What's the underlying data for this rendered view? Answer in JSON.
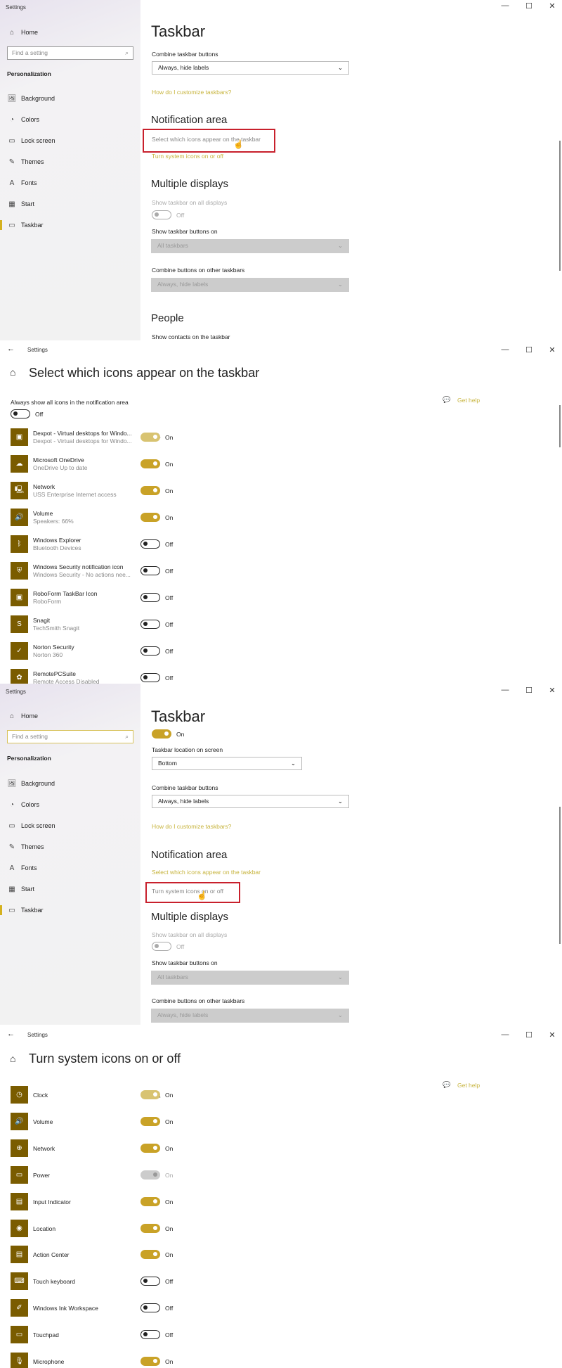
{
  "window": {
    "title": "Settings",
    "minimize": "—",
    "maximize": "☐",
    "close": "✕",
    "back": "←"
  },
  "sidebar": {
    "home": "Home",
    "search_placeholder": "Find a setting",
    "search_icon": "⌕",
    "section": "Personalization",
    "items": [
      {
        "label": "Background",
        "icon": "🖼"
      },
      {
        "label": "Colors",
        "icon": "◔"
      },
      {
        "label": "Lock screen",
        "icon": "▭"
      },
      {
        "label": "Themes",
        "icon": "✎"
      },
      {
        "label": "Fonts",
        "icon": "A"
      },
      {
        "label": "Start",
        "icon": "▦"
      },
      {
        "label": "Taskbar",
        "icon": "▭",
        "selected": true
      }
    ]
  },
  "taskbar_page": {
    "title": "Taskbar",
    "lock_toggle_state": "On",
    "location_label": "Taskbar location on screen",
    "location_value": "Bottom",
    "combine_label": "Combine taskbar buttons",
    "combine_value": "Always, hide labels",
    "customize_link": "How do I customize taskbars?",
    "notification_heading": "Notification area",
    "select_icons_link": "Select which icons appear on the taskbar",
    "system_icons_link": "Turn system icons on or off",
    "multiple_heading": "Multiple displays",
    "show_all_displays_label": "Show taskbar on all displays",
    "show_all_displays_state": "Off",
    "buttons_on_label": "Show taskbar buttons on",
    "buttons_on_value": "All taskbars",
    "combine_other_label": "Combine buttons on other taskbars",
    "combine_other_value": "Always, hide labels",
    "people_heading": "People",
    "show_contacts_label": "Show contacts on the taskbar"
  },
  "select_icons_page": {
    "title": "Select which icons appear on the taskbar",
    "get_help": "Get help",
    "always_show_label": "Always show all icons in the notification area",
    "always_show_state": "Off",
    "items": [
      {
        "name": "Dexpot - Virtual desktops for Windo...",
        "sub": "Dexpot - Virtual desktops for Windo...",
        "state": "On",
        "icon": "▣",
        "hover": true
      },
      {
        "name": "Microsoft OneDrive",
        "sub": "OneDrive Up to date",
        "state": "On",
        "icon": "☁"
      },
      {
        "name": "Network",
        "sub": "USS Enterprise Internet access",
        "state": "On",
        "icon": "🖳"
      },
      {
        "name": "Volume",
        "sub": "Speakers: 66%",
        "state": "On",
        "icon": "🔊"
      },
      {
        "name": "Windows Explorer",
        "sub": "Bluetooth Devices",
        "state": "Off",
        "icon": "ᛒ"
      },
      {
        "name": "Windows Security notification icon",
        "sub": "Windows Security - No actions nee...",
        "state": "Off",
        "icon": "⛨"
      },
      {
        "name": "RoboForm TaskBar Icon",
        "sub": "RoboForm",
        "state": "Off",
        "icon": "▣"
      },
      {
        "name": "Snagit",
        "sub": "TechSmith Snagit",
        "state": "Off",
        "icon": "S"
      },
      {
        "name": "Norton Security",
        "sub": "Norton 360",
        "state": "Off",
        "icon": "✓"
      },
      {
        "name": "RemotePCSuite",
        "sub": "Remote Access Disabled",
        "state": "Off",
        "icon": "✿"
      }
    ]
  },
  "system_icons_page": {
    "title": "Turn system icons on or off",
    "get_help": "Get help",
    "items": [
      {
        "name": "Clock",
        "state": "On",
        "icon": "◷",
        "hover": true
      },
      {
        "name": "Volume",
        "state": "On",
        "icon": "🔊"
      },
      {
        "name": "Network",
        "state": "On",
        "icon": "⊕"
      },
      {
        "name": "Power",
        "state": "On",
        "icon": "▭",
        "disabled": true
      },
      {
        "name": "Input Indicator",
        "state": "On",
        "icon": "▤"
      },
      {
        "name": "Location",
        "state": "On",
        "icon": "◉"
      },
      {
        "name": "Action Center",
        "state": "On",
        "icon": "▤"
      },
      {
        "name": "Touch keyboard",
        "state": "Off",
        "icon": "⌨"
      },
      {
        "name": "Windows Ink Workspace",
        "state": "Off",
        "icon": "✐"
      },
      {
        "name": "Touchpad",
        "state": "Off",
        "icon": "▭"
      },
      {
        "name": "Microphone",
        "state": "On",
        "icon": "🎙"
      }
    ]
  },
  "colors": {
    "accent": "#c9a227",
    "icon_bg": "#7a5c00",
    "link": "#c7b43e",
    "highlight": "#c8202c"
  }
}
